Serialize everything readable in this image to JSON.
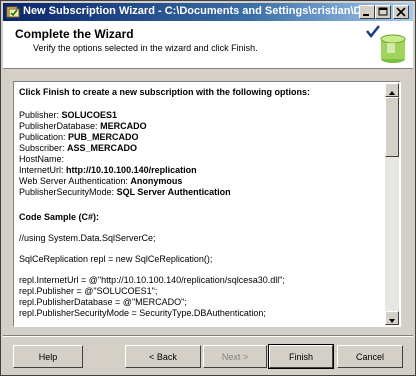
{
  "window": {
    "title": "New Subscription Wizard - C:\\Documents and Settings\\cristian\\Deskto...",
    "accent_color": "#0a246a"
  },
  "header": {
    "title": "Complete the Wizard",
    "subtitle": "Verify the options selected in the wizard and click Finish.",
    "icon": "checkmark-database-icon"
  },
  "summary": {
    "intro": "Click Finish to create a new subscription with the following options:",
    "options": [
      {
        "label": "Publisher:",
        "value": "SOLUCOES1"
      },
      {
        "label": "PublisherDatabase:",
        "value": "MERCADO"
      },
      {
        "label": "Publication:",
        "value": "PUB_MERCADO"
      },
      {
        "label": "Subscriber:",
        "value": "ASS_MERCADO"
      },
      {
        "label": "HostName:",
        "value": ""
      },
      {
        "label": "InternetUrl:",
        "value": "http://10.10.100.140/replication"
      },
      {
        "label": "Web Server Authentication:",
        "value": "Anonymous"
      },
      {
        "label": "PublisherSecurityMode:",
        "value": "SQL Server Authentication"
      }
    ],
    "code_title": "Code Sample (C#):",
    "code_lines": [
      "//using System.Data.SqlServerCe;",
      "",
      "SqlCeReplication repl = new SqlCeReplication();",
      "",
      "repl.InternetUrl = @\"http://10.10.100.140/replication/sqlcesa30.dll\";",
      "repl.Publisher = @\"SOLUCOES1\";",
      "repl.PublisherDatabase = @\"MERCADO\";",
      "repl.PublisherSecurityMode = SecurityType.DBAuthentication;"
    ]
  },
  "buttons": {
    "help": "Help",
    "back": "< Back",
    "next": "Next >",
    "finish": "Finish",
    "cancel": "Cancel"
  }
}
